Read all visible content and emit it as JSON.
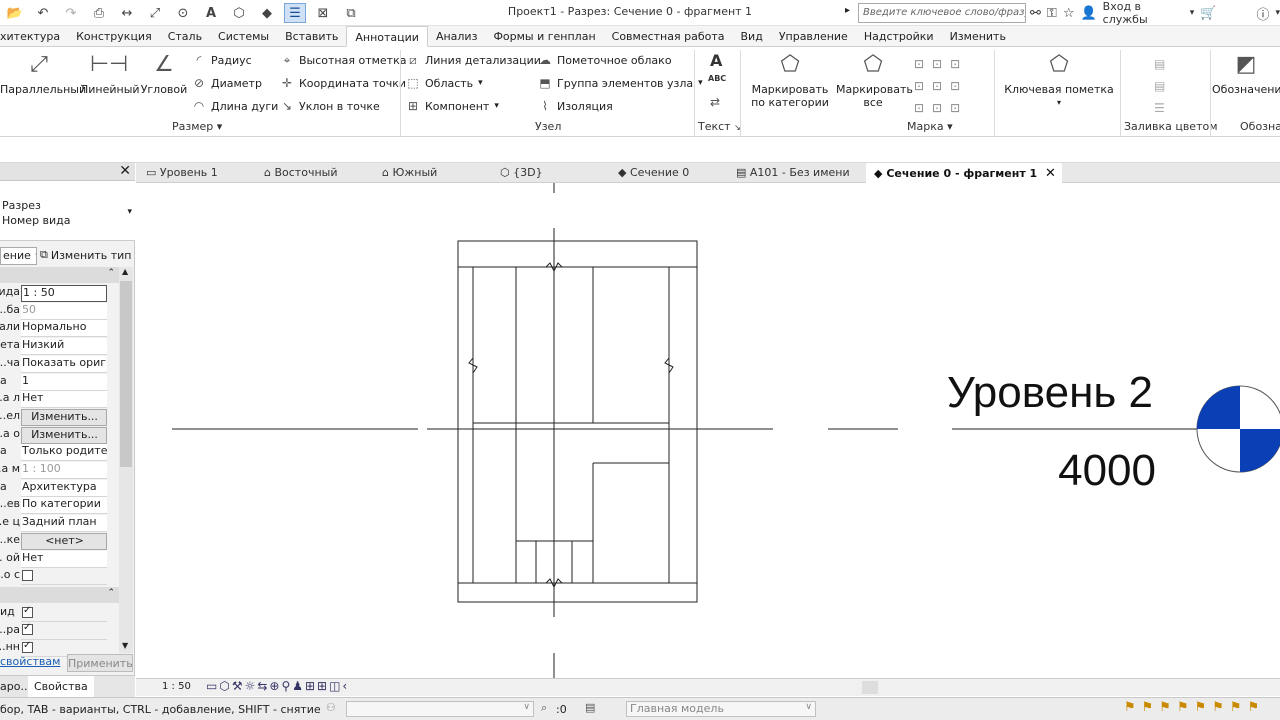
{
  "window": {
    "title": "Проект1 - Разрез: Сечение 0 - фрагмент 1"
  },
  "search": {
    "placeholder": "Введите ключевое слово/фразу"
  },
  "account": {
    "signin": "Вход в службы"
  },
  "ribbon_tabs": [
    "хитектура",
    "Конструкция",
    "Сталь",
    "Системы",
    "Вставить",
    "Аннотации",
    "Анализ",
    "Формы и генплан",
    "Совместная работа",
    "Вид",
    "Управление",
    "Надстройки",
    "Изменить"
  ],
  "ribbon": {
    "dim": {
      "parallel": "Параллельный",
      "linear": "Линейный",
      "angular": "Угловой",
      "radius": "Радиус",
      "diameter": "Диаметр",
      "arc_length": "Длина дуги",
      "spot_elev": "Высотная отметка",
      "spot_coord": "Координата точки",
      "spot_slope": "Уклон  в точке",
      "panel": "Размер"
    },
    "detail": {
      "detail_line": "Линия детализации",
      "region": "Область",
      "component": "Компонент",
      "revision_cloud": "Пометочное облако",
      "detail_group": "Группа элементов узла",
      "insulation": "Изоляция",
      "panel": "Узел"
    },
    "text": {
      "panel": "Текст",
      "abc": "ABC"
    },
    "tag": {
      "by_category": "Маркировать по категории",
      "all": "Маркировать все",
      "panel": "Марка"
    },
    "keynote": {
      "label": "Ключевая пометка"
    },
    "color_fill": {
      "panel": "Заливка цветом"
    },
    "symbol": {
      "label": "Обозначени",
      "panel": "Обозна"
    }
  },
  "properties": {
    "type_family": "Разрез",
    "type_name": "Номер вида",
    "selector": "ение",
    "edit_type": "Изменить тип",
    "rows": [
      {
        "k": "ида",
        "v": "1 : 50"
      },
      {
        "k": "ба...",
        "v": "50",
        "gray": true
      },
      {
        "k": "али...",
        "v": "Нормально"
      },
      {
        "k": "ета...",
        "v": "Низкий"
      },
      {
        "k": "ча...",
        "v": "Показать ориг..."
      },
      {
        "k": "а",
        "v": "1"
      },
      {
        "k": "а л...",
        "v": "Нет"
      },
      {
        "k": "ел...",
        "v": "Изменить...",
        "btn": true
      },
      {
        "k": "а о...",
        "v": "Изменить...",
        "btn": true
      },
      {
        "k": "а",
        "v": "Только родите..."
      },
      {
        "k": "а м...",
        "v": "1 : 100",
        "gray": true
      },
      {
        "k": "а",
        "v": "Архитектура"
      },
      {
        "k": "ев...",
        "v": "По категории"
      },
      {
        "k": "е ц...",
        "v": "Задний план"
      },
      {
        "k": "ке...",
        "v": "<нет>",
        "btn": true
      },
      {
        "k": "ой ...",
        "v": "Нет"
      },
      {
        "k": "о с...",
        "v": "",
        "chk": false
      }
    ],
    "rows2": [
      {
        "k": "ид",
        "chk": true
      },
      {
        "k": "ра...",
        "chk": true
      },
      {
        "k": "нн...",
        "chk": true
      }
    ],
    "link": "свойствам",
    "apply": "Применить",
    "bottom_tab1": "аро...",
    "bottom_tab2": "Свойства"
  },
  "view_tabs": [
    {
      "label": "Уровень 1",
      "icon": "floorplan-icon"
    },
    {
      "label": "Восточный",
      "icon": "elevation-icon"
    },
    {
      "label": "Южный",
      "icon": "elevation-icon"
    },
    {
      "label": "{3D}",
      "icon": "3d-icon"
    },
    {
      "label": "Сечение 0",
      "icon": "section-icon"
    },
    {
      "label": "A101 - Без имени",
      "icon": "sheet-icon"
    },
    {
      "label": "Сечение 0 - фрагмент 1",
      "icon": "section-icon",
      "active": true
    }
  ],
  "drawing": {
    "level_name": "Уровень 2",
    "level_elev": "4000",
    "level_head_color": "#0a3fb5"
  },
  "viewbar": {
    "scale": "1 : 50"
  },
  "status": {
    "hint": "бор, TAB - варианты, CTRL - добавление, SHIFT - снятие выбор",
    "count": ":0",
    "model": "Главная модель"
  }
}
